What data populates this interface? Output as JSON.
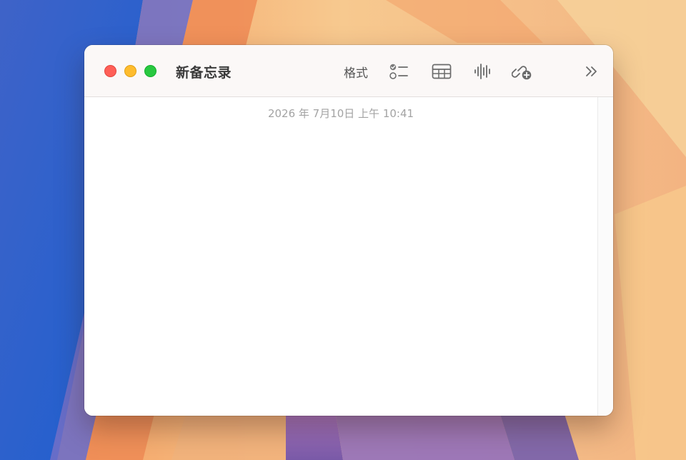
{
  "window": {
    "title": "新备忘录",
    "controls": [
      "close",
      "minimize",
      "zoom"
    ],
    "colors": {
      "close": "#ff5f57",
      "minimize": "#febc2e",
      "zoom": "#28c840"
    }
  },
  "toolbar": {
    "format_label": "格式",
    "icons": [
      "checklist-icon",
      "table-icon",
      "audio-waveform-icon",
      "link-collaborate-icon",
      "chevron-double-right-icon"
    ]
  },
  "note": {
    "timestamp": "2026 年 7月10日 上午 10:41",
    "body": ""
  }
}
